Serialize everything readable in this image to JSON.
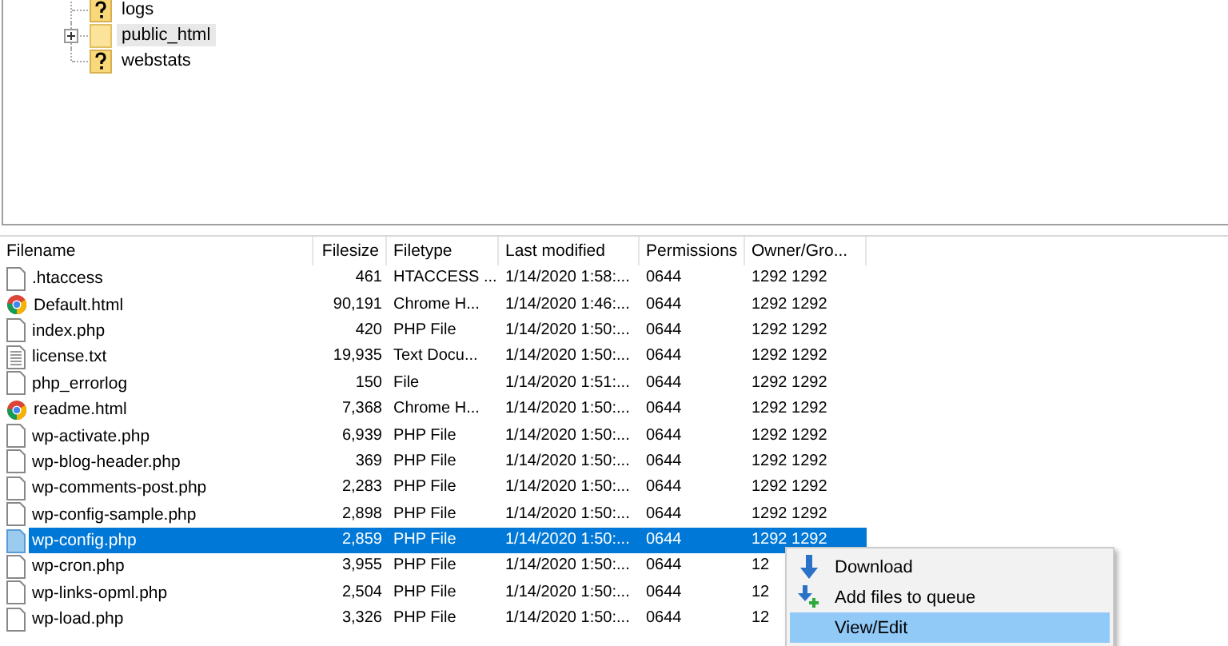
{
  "tree": [
    {
      "name": "logs",
      "kind": "unknown",
      "expandable": false,
      "selected": false
    },
    {
      "name": "public_html",
      "kind": "folder",
      "expandable": true,
      "selected": true
    },
    {
      "name": "webstats",
      "kind": "unknown",
      "expandable": false,
      "selected": false
    }
  ],
  "columns": [
    "Filename",
    "Filesize",
    "Filetype",
    "Last modified",
    "Permissions",
    "Owner/Gro..."
  ],
  "rows": [
    {
      "kind": "file",
      "selected": false,
      "cells": [
        ".htaccess",
        "461",
        "HTACCESS ...",
        "1/14/2020 1:58:...",
        "0644",
        "1292 1292"
      ]
    },
    {
      "kind": "chrome",
      "selected": false,
      "cells": [
        "Default.html",
        "90,191",
        "Chrome H...",
        "1/14/2020 1:46:...",
        "0644",
        "1292 1292"
      ]
    },
    {
      "kind": "file",
      "selected": false,
      "cells": [
        "index.php",
        "420",
        "PHP File",
        "1/14/2020 1:50:...",
        "0644",
        "1292 1292"
      ]
    },
    {
      "kind": "text",
      "selected": false,
      "cells": [
        "license.txt",
        "19,935",
        "Text Docu...",
        "1/14/2020 1:50:...",
        "0644",
        "1292 1292"
      ]
    },
    {
      "kind": "file",
      "selected": false,
      "cells": [
        "php_errorlog",
        "150",
        "File",
        "1/14/2020 1:51:...",
        "0644",
        "1292 1292"
      ]
    },
    {
      "kind": "chrome",
      "selected": false,
      "cells": [
        "readme.html",
        "7,368",
        "Chrome H...",
        "1/14/2020 1:50:...",
        "0644",
        "1292 1292"
      ]
    },
    {
      "kind": "file",
      "selected": false,
      "cells": [
        "wp-activate.php",
        "6,939",
        "PHP File",
        "1/14/2020 1:50:...",
        "0644",
        "1292 1292"
      ]
    },
    {
      "kind": "file",
      "selected": false,
      "cells": [
        "wp-blog-header.php",
        "369",
        "PHP File",
        "1/14/2020 1:50:...",
        "0644",
        "1292 1292"
      ]
    },
    {
      "kind": "file",
      "selected": false,
      "cells": [
        "wp-comments-post.php",
        "2,283",
        "PHP File",
        "1/14/2020 1:50:...",
        "0644",
        "1292 1292"
      ]
    },
    {
      "kind": "file",
      "selected": false,
      "cells": [
        "wp-config-sample.php",
        "2,898",
        "PHP File",
        "1/14/2020 1:50:...",
        "0644",
        "1292 1292"
      ]
    },
    {
      "kind": "file",
      "selected": true,
      "cells": [
        "wp-config.php",
        "2,859",
        "PHP File",
        "1/14/2020 1:50:...",
        "0644",
        "1292 1292"
      ]
    },
    {
      "kind": "file",
      "selected": false,
      "cells": [
        "wp-cron.php",
        "3,955",
        "PHP File",
        "1/14/2020 1:50:...",
        "0644",
        "12"
      ]
    },
    {
      "kind": "file",
      "selected": false,
      "cells": [
        "wp-links-opml.php",
        "2,504",
        "PHP File",
        "1/14/2020 1:50:...",
        "0644",
        "12"
      ]
    },
    {
      "kind": "file",
      "selected": false,
      "cells": [
        "wp-load.php",
        "3,326",
        "PHP File",
        "1/14/2020 1:50:...",
        "0644",
        "12"
      ]
    }
  ],
  "context_menu": [
    {
      "label": "Download",
      "kind": "download",
      "selected": false
    },
    {
      "label": "Add files to queue",
      "kind": "queue",
      "selected": false
    },
    {
      "label": "View/Edit",
      "kind": "none",
      "selected": true
    }
  ]
}
